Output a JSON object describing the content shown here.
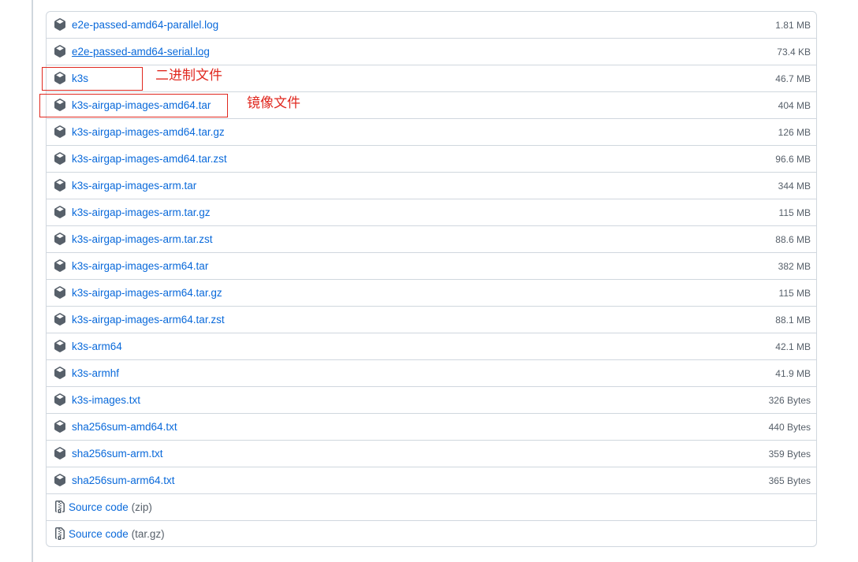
{
  "assets": [
    {
      "name": "e2e-passed-amd64-parallel.log",
      "size": "1.81 MB",
      "underline": false
    },
    {
      "name": "e2e-passed-amd64-serial.log",
      "size": "73.4 KB",
      "underline": true
    },
    {
      "name": "k3s",
      "size": "46.7 MB",
      "underline": false
    },
    {
      "name": "k3s-airgap-images-amd64.tar",
      "size": "404 MB",
      "underline": false
    },
    {
      "name": "k3s-airgap-images-amd64.tar.gz",
      "size": "126 MB",
      "underline": false
    },
    {
      "name": "k3s-airgap-images-amd64.tar.zst",
      "size": "96.6 MB",
      "underline": false
    },
    {
      "name": "k3s-airgap-images-arm.tar",
      "size": "344 MB",
      "underline": false
    },
    {
      "name": "k3s-airgap-images-arm.tar.gz",
      "size": "115 MB",
      "underline": false
    },
    {
      "name": "k3s-airgap-images-arm.tar.zst",
      "size": "88.6 MB",
      "underline": false
    },
    {
      "name": "k3s-airgap-images-arm64.tar",
      "size": "382 MB",
      "underline": false
    },
    {
      "name": "k3s-airgap-images-arm64.tar.gz",
      "size": "115 MB",
      "underline": false
    },
    {
      "name": "k3s-airgap-images-arm64.tar.zst",
      "size": "88.1 MB",
      "underline": false
    },
    {
      "name": "k3s-arm64",
      "size": "42.1 MB",
      "underline": false
    },
    {
      "name": "k3s-armhf",
      "size": "41.9 MB",
      "underline": false
    },
    {
      "name": "k3s-images.txt",
      "size": "326 Bytes",
      "underline": false
    },
    {
      "name": "sha256sum-amd64.txt",
      "size": "440 Bytes",
      "underline": false
    },
    {
      "name": "sha256sum-arm.txt",
      "size": "359 Bytes",
      "underline": false
    },
    {
      "name": "sha256sum-arm64.txt",
      "size": "365 Bytes",
      "underline": false
    }
  ],
  "source_code": [
    {
      "label": "Source code",
      "format": "(zip)"
    },
    {
      "label": "Source code",
      "format": "(tar.gz)"
    }
  ],
  "annotations": {
    "binary_label": "二进制文件",
    "image_label": "镜像文件"
  },
  "icons": {
    "asset": "package-icon",
    "source": "file-zip-icon"
  },
  "colors": {
    "link": "#0969da",
    "muted": "#57606a",
    "border": "#d0d7de",
    "annotation": "#e0281f"
  }
}
